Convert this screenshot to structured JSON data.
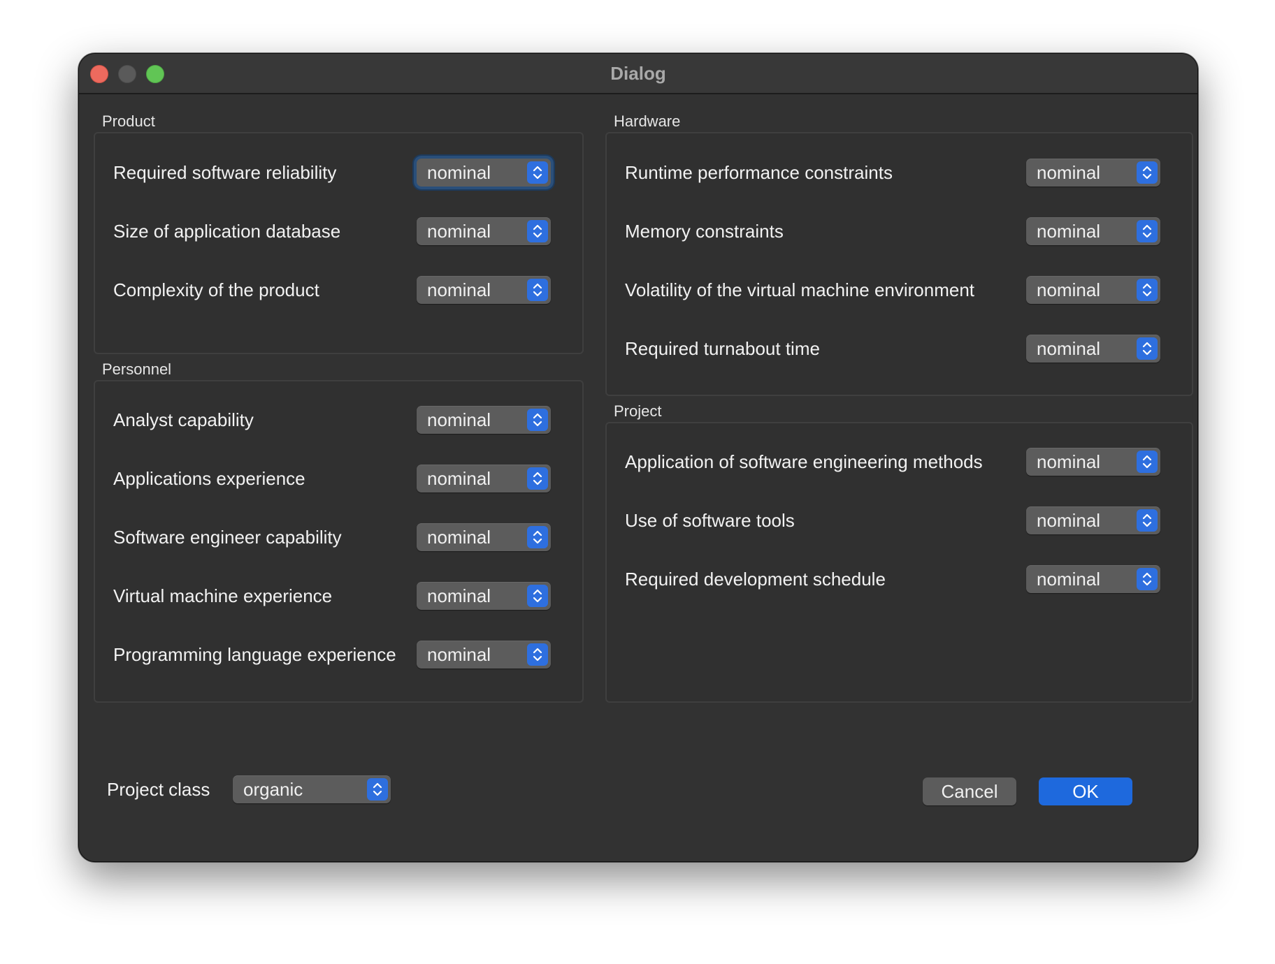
{
  "window": {
    "title": "Dialog"
  },
  "product": {
    "label": "Product",
    "rows": [
      {
        "label": "Required software reliability",
        "value": "nominal"
      },
      {
        "label": "Size of application database",
        "value": "nominal"
      },
      {
        "label": "Complexity of the product",
        "value": "nominal"
      }
    ]
  },
  "personnel": {
    "label": "Personnel",
    "rows": [
      {
        "label": "Analyst capability",
        "value": "nominal"
      },
      {
        "label": "Applications experience",
        "value": "nominal"
      },
      {
        "label": "Software engineer capability",
        "value": "nominal"
      },
      {
        "label": "Virtual machine experience",
        "value": "nominal"
      },
      {
        "label": "Programming language experience",
        "value": "nominal"
      }
    ]
  },
  "hardware": {
    "label": "Hardware",
    "rows": [
      {
        "label": "Runtime performance constraints",
        "value": "nominal"
      },
      {
        "label": "Memory constraints",
        "value": "nominal"
      },
      {
        "label": "Volatility of the virtual machine environment",
        "value": "nominal"
      },
      {
        "label": "Required turnabout time",
        "value": "nominal"
      }
    ]
  },
  "project": {
    "label": "Project",
    "rows": [
      {
        "label": "Application of software engineering methods",
        "value": "nominal"
      },
      {
        "label": "Use of software tools",
        "value": "nominal"
      },
      {
        "label": "Required development schedule",
        "value": "nominal"
      }
    ]
  },
  "footer": {
    "project_class_label": "Project class",
    "project_class_value": "organic",
    "cancel_label": "Cancel",
    "ok_label": "OK"
  },
  "colors": {
    "accent": "#1e69dd",
    "window_bg": "#323232",
    "close": "#ed6a5e",
    "zoom": "#61c555"
  }
}
